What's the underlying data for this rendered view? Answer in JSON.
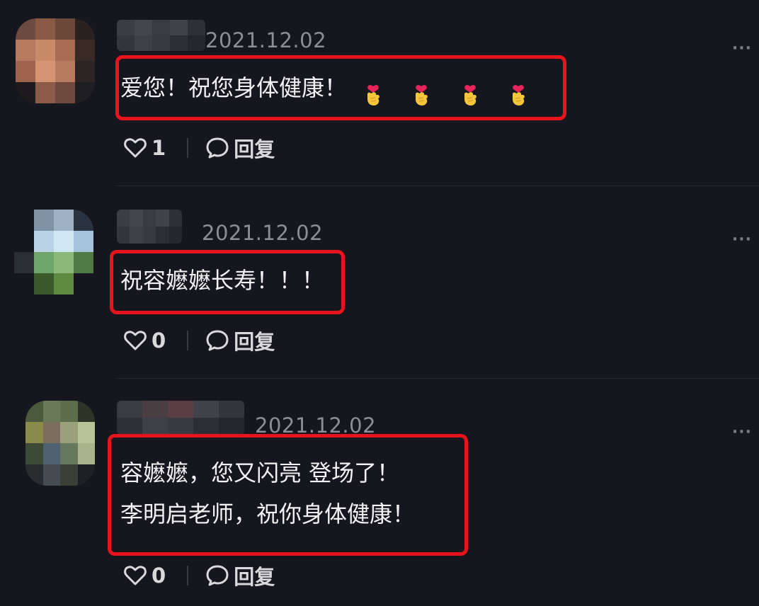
{
  "comments": [
    {
      "date": "2021.12.02",
      "text": "爱您！祝您身体健康！",
      "emoji_name": "heart-hands-emoji",
      "emoji_count": 4,
      "likes": "1",
      "reply_label": "回复",
      "more_label": "···"
    },
    {
      "date": "2021.12.02",
      "text": "祝容嬷嬷长寿！！！",
      "likes": "0",
      "reply_label": "回复",
      "more_label": "···"
    },
    {
      "date": "2021.12.02",
      "text_line1": "容嬷嬷，您又闪亮 登场了！",
      "text_line2": "李明启老师，祝你身体健康！",
      "likes": "0",
      "reply_label": "回复",
      "more_label": "···"
    }
  ],
  "colors": {
    "background": "#16171e",
    "highlight": "#e8141d",
    "text": "#f2f2f4",
    "muted": "#8d8e93"
  }
}
